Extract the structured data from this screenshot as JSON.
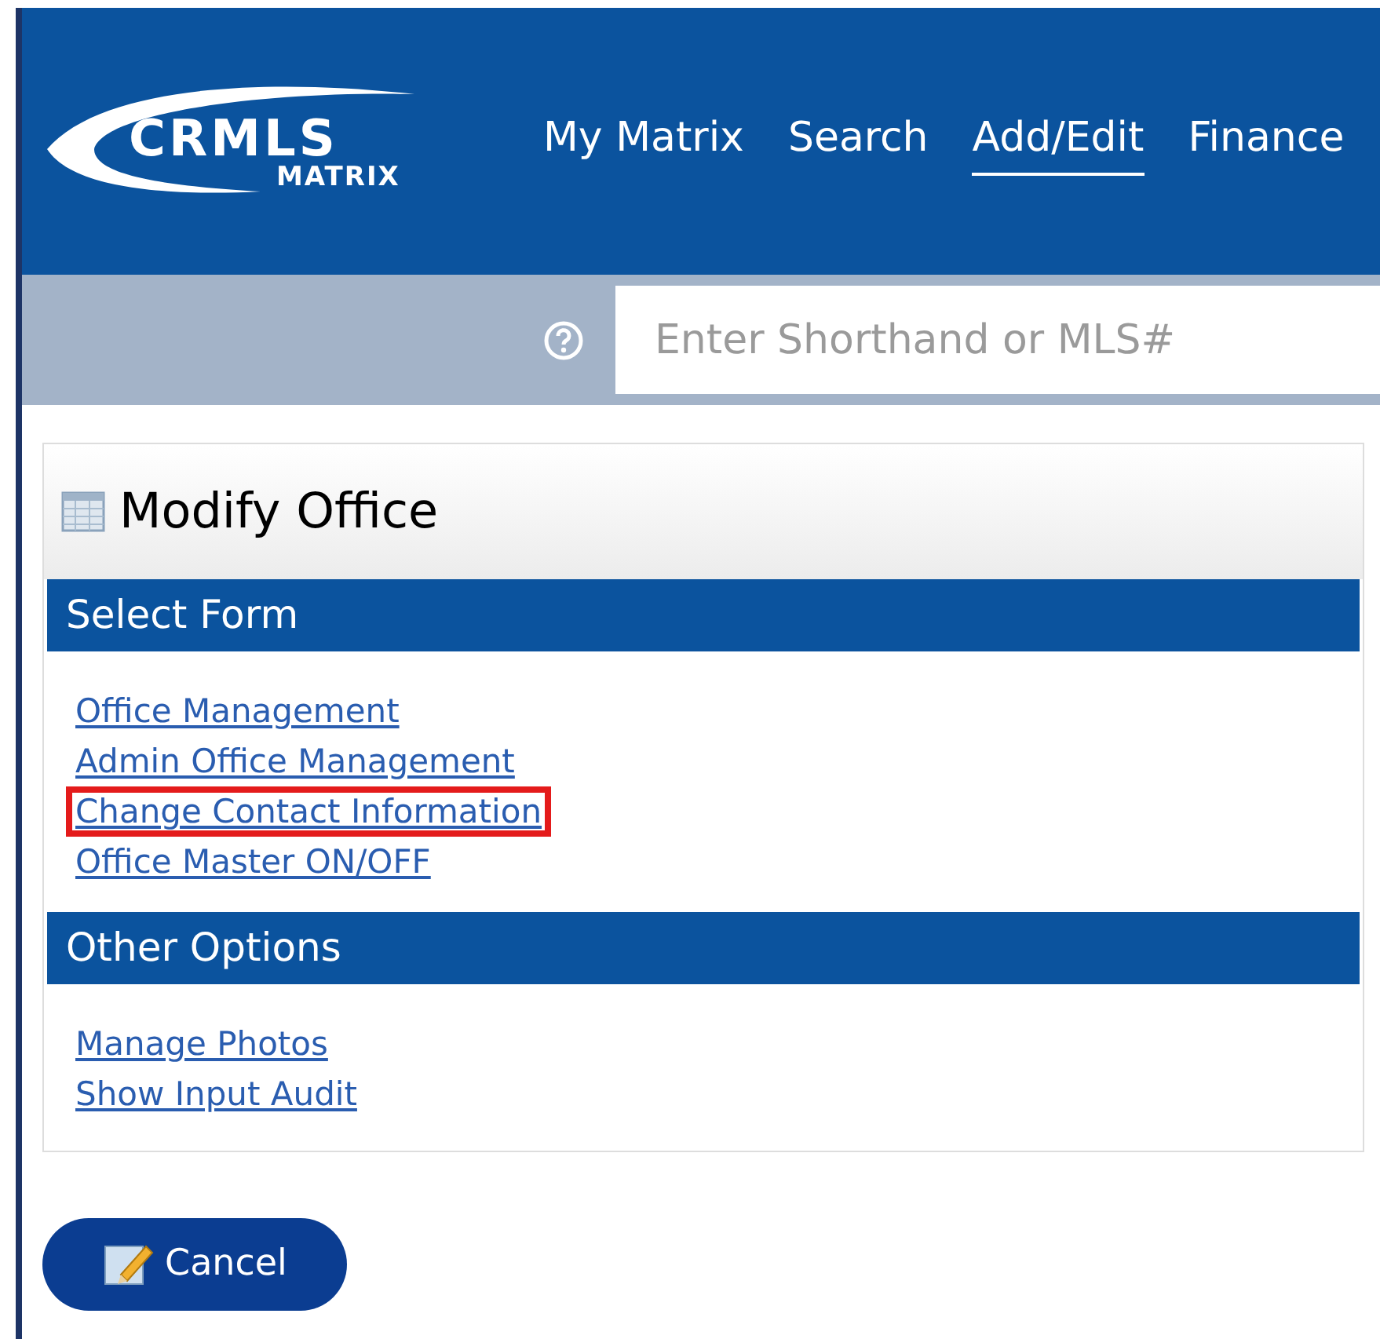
{
  "logo": {
    "brand": "CRMLS",
    "product": "MATRIX"
  },
  "nav": [
    {
      "label": "My Matrix",
      "selected": false
    },
    {
      "label": "Search",
      "selected": false
    },
    {
      "label": "Add/Edit",
      "selected": true
    },
    {
      "label": "Finance",
      "selected": false
    }
  ],
  "search": {
    "placeholder": "Enter Shorthand or MLS#"
  },
  "panel": {
    "title": "Modify Office",
    "sections": [
      {
        "title": "Select Form",
        "links": [
          {
            "label": "Office Management",
            "highlighted": false
          },
          {
            "label": "Admin Office Management",
            "highlighted": false
          },
          {
            "label": "Change Contact Information",
            "highlighted": true
          },
          {
            "label": "Office Master ON/OFF",
            "highlighted": false
          }
        ]
      },
      {
        "title": "Other Options",
        "links": [
          {
            "label": "Manage Photos",
            "highlighted": false
          },
          {
            "label": "Show Input Audit",
            "highlighted": false
          }
        ]
      }
    ]
  },
  "buttons": [
    {
      "label": "Cancel"
    }
  ]
}
